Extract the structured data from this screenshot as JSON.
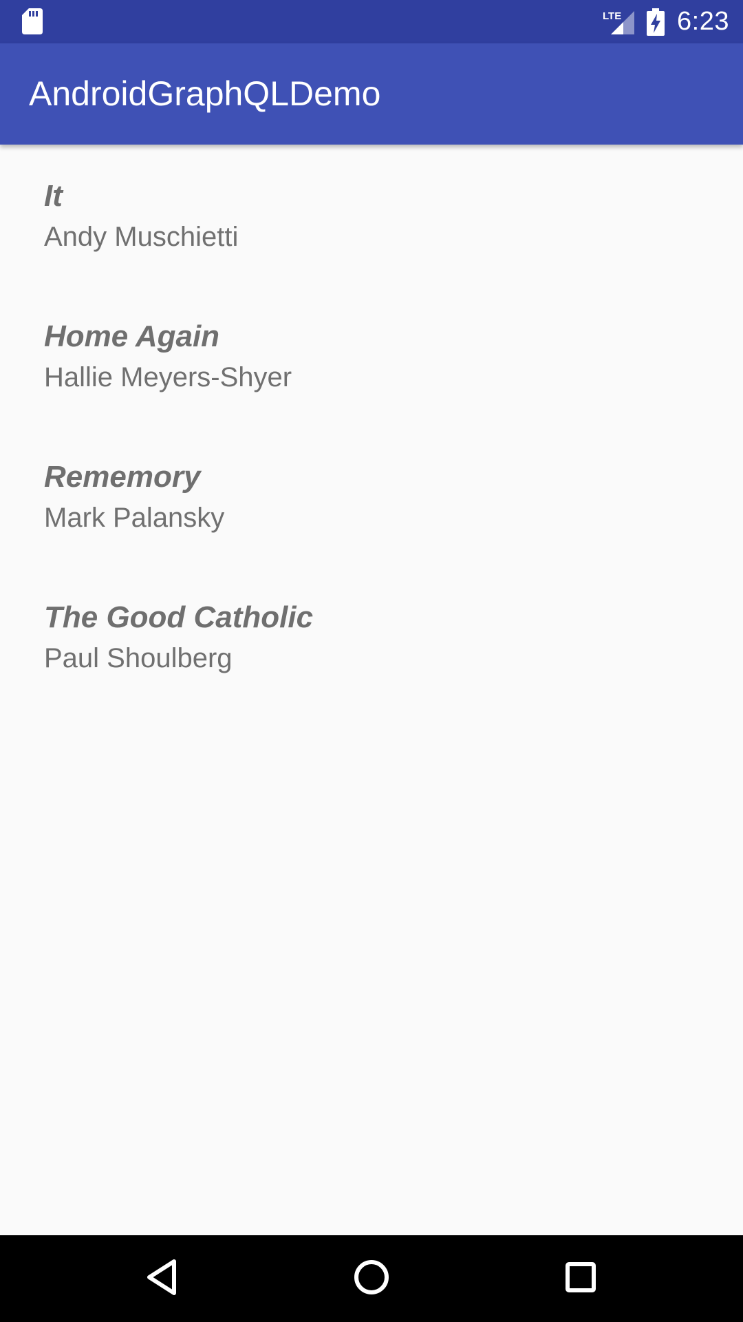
{
  "status_bar": {
    "time": "6:23",
    "network_label": "LTE",
    "icons": [
      "sd-card-icon",
      "lte-signal-icon",
      "battery-charging-icon"
    ],
    "color": "#303F9F"
  },
  "app_bar": {
    "title": "AndroidGraphQLDemo",
    "color": "#3F51B5"
  },
  "movies": [
    {
      "title": "It",
      "director": "Andy Muschietti"
    },
    {
      "title": "Home Again",
      "director": "Hallie Meyers-Shyer"
    },
    {
      "title": "Rememory",
      "director": "Mark Palansky"
    },
    {
      "title": "The Good Catholic",
      "director": "Paul Shoulberg"
    }
  ],
  "nav_bar": {
    "buttons": [
      "back-icon",
      "home-icon",
      "recents-icon"
    ]
  }
}
